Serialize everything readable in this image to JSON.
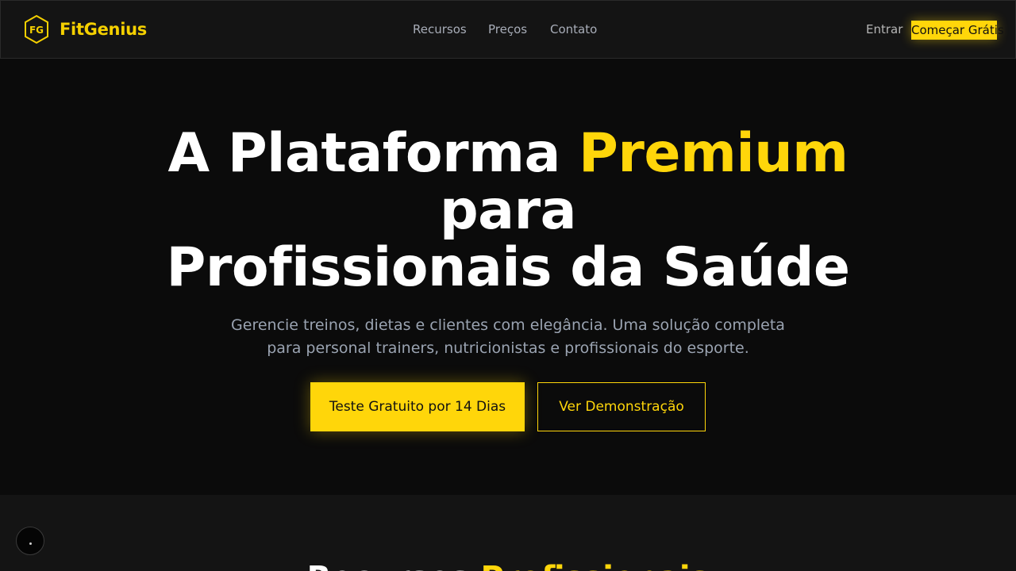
{
  "brand": {
    "name": "FitGenius",
    "logo_monogram": "FG",
    "accent_color": "#ffd60a"
  },
  "nav": {
    "items": [
      "Recursos",
      "Preços",
      "Contato"
    ]
  },
  "header_actions": {
    "signin_label": "Entrar",
    "cta_label": "Começar Grátis"
  },
  "hero": {
    "title_part1": "A Plataforma ",
    "title_accent": "Premium",
    "title_line2": "para",
    "title_line3": "Profissionais da Saúde",
    "subtitle_line1": "Gerencie treinos, dietas e clientes com elegância. Uma solução completa",
    "subtitle_line2": "para personal trainers, nutricionistas e profissionais do esporte.",
    "primary_button": "Teste Gratuito por 14 Dias",
    "secondary_button": "Ver Demonstração"
  },
  "section2": {
    "title_part1": "Recursos ",
    "title_accent": "Profissionais"
  },
  "colors": {
    "background": "#0b0b0b",
    "header_bg": "#141414",
    "muted_text": "#9aa3b1"
  }
}
